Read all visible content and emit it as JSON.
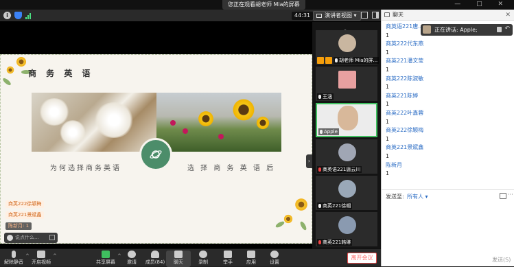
{
  "window": {
    "share_banner": "您正在观看胡老师 Mia的屏幕",
    "controls": "— □ ✕"
  },
  "meeting_bar": {
    "timer": "44:31",
    "view_label": "演讲者视图",
    "info_label": "i"
  },
  "slide": {
    "title": "商 务 英 语",
    "caption_left": "为何选择商务英语",
    "caption_right": "选 择 商 务 英 语 后"
  },
  "danmaku": [
    "商英222徐颖梅",
    "商英221景斌鑫",
    "陈新月: 1"
  ],
  "mini_chat": {
    "placeholder": "说点什么..."
  },
  "gallery": {
    "tiles": [
      {
        "name": "胡老师 Mia的屏...",
        "avatar_color": "#c9b6a0",
        "muted": false
      },
      {
        "name": "王涵",
        "avatar_color": "#e8a0a0",
        "muted": false
      },
      {
        "name": "Apple",
        "avatar_color": "#d8b89a",
        "muted": false
      },
      {
        "name": "商英语221唐云川",
        "avatar_color": "#a0a6b4",
        "muted": true
      },
      {
        "name": "商英221徐帽",
        "avatar_color": "#9aa8b8",
        "muted": false
      },
      {
        "name": "商英221韩琳",
        "avatar_color": "#8a9ab0",
        "muted": true
      }
    ]
  },
  "toolbar": {
    "unmute": "解除静音",
    "video": "开启视频",
    "share": "共享屏幕",
    "invite": "邀请",
    "members": "成员(84)",
    "chat": "聊天",
    "record": "录制",
    "raise_hand": "举手",
    "apps": "应用",
    "settings": "设置",
    "leave": "离开会议"
  },
  "chat": {
    "title": "聊天",
    "close": "✕",
    "speaker_label": "正在讲话: Apple;",
    "messages": [
      {
        "type": "sender",
        "text": "商英语221唐..."
      },
      {
        "type": "msg",
        "text": "1"
      },
      {
        "type": "sender",
        "text": "商英222代东燕"
      },
      {
        "type": "msg",
        "text": "1"
      },
      {
        "type": "sender",
        "text": "商英221潘文莹"
      },
      {
        "type": "msg",
        "text": "1"
      },
      {
        "type": "sender",
        "text": "商英222陈淑敏"
      },
      {
        "type": "msg",
        "text": "1"
      },
      {
        "type": "sender",
        "text": "商英221陈婷"
      },
      {
        "type": "msg",
        "text": "1"
      },
      {
        "type": "sender",
        "text": "商英222叶鑫蓉"
      },
      {
        "type": "msg",
        "text": "1"
      },
      {
        "type": "sender",
        "text": "商英222徐颖梅"
      },
      {
        "type": "msg",
        "text": "1"
      },
      {
        "type": "sender",
        "text": "商英221景斌鑫"
      },
      {
        "type": "msg",
        "text": "1"
      },
      {
        "type": "sender",
        "text": "陈新月"
      },
      {
        "type": "msg",
        "text": "1"
      }
    ],
    "send_to_label": "发送至:",
    "send_to_value": "所有人 ▾",
    "send_button": "发送(S)",
    "more": "···"
  }
}
